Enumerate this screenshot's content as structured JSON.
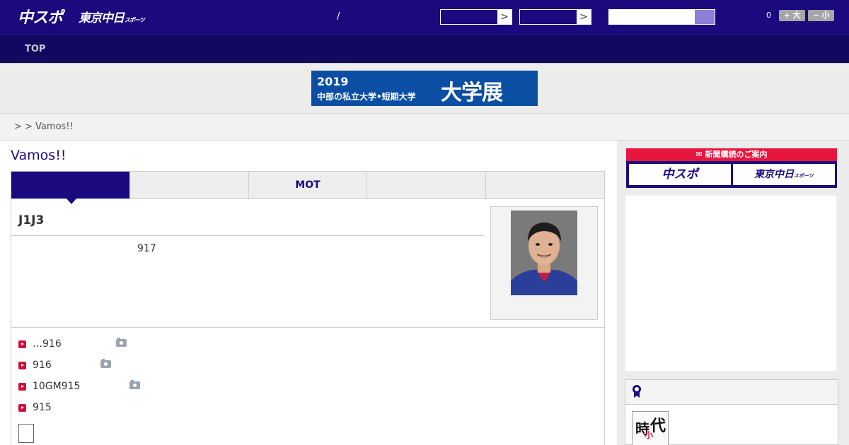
{
  "header": {
    "logo_main": "中スポ",
    "logo_tokyo": "東京中日",
    "logo_tokyo_sub": "スポーツ",
    "separator": "/",
    "select_1_arrow": ">",
    "select_2_arrow": ">",
    "search_placeholder": "",
    "count": "0",
    "font_large_label": "+ 大",
    "font_small_label": "− 小",
    "bg_color": "#1a0a7e"
  },
  "nav": {
    "items": [
      {
        "label": "TOP"
      }
    ]
  },
  "banner": {
    "year": "2019",
    "subtitle": "中部の私立大学•短期大学",
    "big": "大学展"
  },
  "breadcrumb": {
    "text": ">  > Vamos!!"
  },
  "page": {
    "title": "Vamos!!"
  },
  "tabs": [
    {
      "label": "",
      "active": true
    },
    {
      "label": "",
      "active": false
    },
    {
      "label": "MOT",
      "active": false
    },
    {
      "label": "",
      "active": false
    },
    {
      "label": "",
      "active": false
    }
  ],
  "article": {
    "title": "J1J3",
    "text": "917"
  },
  "news": [
    {
      "text": "…916",
      "has_photo": true
    },
    {
      "text": "916",
      "has_photo": true
    },
    {
      "text": "10GM915",
      "has_photo": true
    },
    {
      "text": "915",
      "has_photo": false
    }
  ],
  "subscription": {
    "header": "新聞購読のご案内",
    "btn_chuspo": "中スポ",
    "btn_tokyo": "東京中日",
    "btn_tokyo_sub": "スポーツ"
  },
  "ranking": {
    "icon": "ribbon-icon",
    "thumb_chars": [
      "時",
      "代",
      "小"
    ]
  },
  "colors": {
    "navy": "#1a0a7e",
    "accent_red": "#d0103a",
    "sub_red": "#e8163f",
    "banner_blue": "#0a4fa3"
  }
}
